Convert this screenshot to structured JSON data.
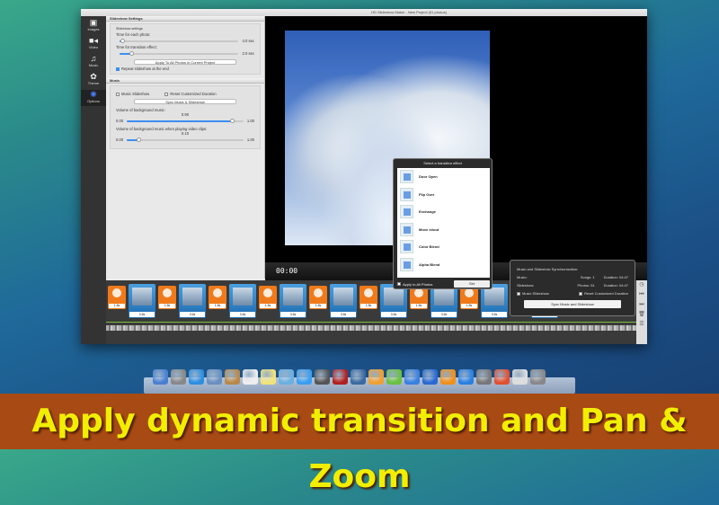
{
  "window": {
    "title": "HD Slideshow Maker - New Project (51 photos)"
  },
  "sidebar": {
    "items": [
      {
        "label": "Images",
        "icon": "image-icon",
        "glyph": "▣"
      },
      {
        "label": "Video",
        "icon": "video-icon",
        "glyph": "■◂"
      },
      {
        "label": "Music",
        "icon": "music-icon",
        "glyph": "♫"
      },
      {
        "label": "Theme",
        "icon": "theme-icon",
        "glyph": "✿"
      },
      {
        "label": "Options",
        "icon": "gear-icon",
        "glyph": "✺",
        "active": true
      }
    ]
  },
  "slideshow_settings": {
    "header": "Slideshow Settings",
    "group": "Slideshow settings",
    "photo_time_label": "Time for each photo:",
    "photo_time_value": "4.0 sec",
    "photo_time_fraction": 0.02,
    "transition_time_label": "Time for transition effect:",
    "transition_time_value": "2.0 sec",
    "transition_time_fraction": 0.1,
    "apply_button": "Apply To All Photos in Current Project",
    "repeat_label": "Repeat slideshow at the end",
    "repeat_checked": true
  },
  "music": {
    "header": "Music",
    "music_slideshow": "Music Slideshow",
    "reset_duration": "Reset Customized Duration",
    "sync_button": "Sync Music & Slideshow",
    "bg_volume_label": "Volume of background music:",
    "bg_volume_value": "0.90",
    "bg_min": "0.00",
    "bg_max": "1.00",
    "video_volume_label": "Volume of background music when playing video clips:",
    "video_volume_value": "0.10",
    "video_min": "0.00",
    "video_max": "1.00"
  },
  "player": {
    "time": "00:00"
  },
  "transition_popup": {
    "title": "Select a transition effect",
    "items": [
      "Door Open",
      "Flip Over",
      "Exchange",
      "Move in/out",
      "Color Blend",
      "Alpha Blend"
    ],
    "apply_all": "Apply to All Photos",
    "set_button": "Set"
  },
  "sync_popup": {
    "title": "Music and Slideshow Synchronization:",
    "music_label": "Music:",
    "songs": "Songs: 1",
    "music_duration": "Duration: 04:47",
    "slideshow_label": "Slideshow:",
    "photos": "Photos: 51",
    "slideshow_duration": "Duration: 04:47",
    "music_slideshow": "Music Slideshow",
    "reset_duration": "Reset Customized Duration",
    "sync_button": "Sync Music and Slideshow"
  },
  "timeline": {
    "clip_duration": "3.6s",
    "transition_duration": "1.8s"
  },
  "dock_colors": [
    "#4a7fd0",
    "#888",
    "#2d8ee0",
    "#6a8fc0",
    "#b8894a",
    "#eee",
    "#f2e27a",
    "#6ab0e0",
    "#3a9ef0",
    "#555",
    "#b02020",
    "#3a6aa0",
    "#f0a030",
    "#6ac040",
    "#3a80e0",
    "#2a6ad0",
    "#f0901a",
    "#2a80e0",
    "#777",
    "#e05030",
    "#ddd",
    "#888"
  ],
  "banner": {
    "text": "Apply dynamic transition and Pan & Zoom"
  }
}
